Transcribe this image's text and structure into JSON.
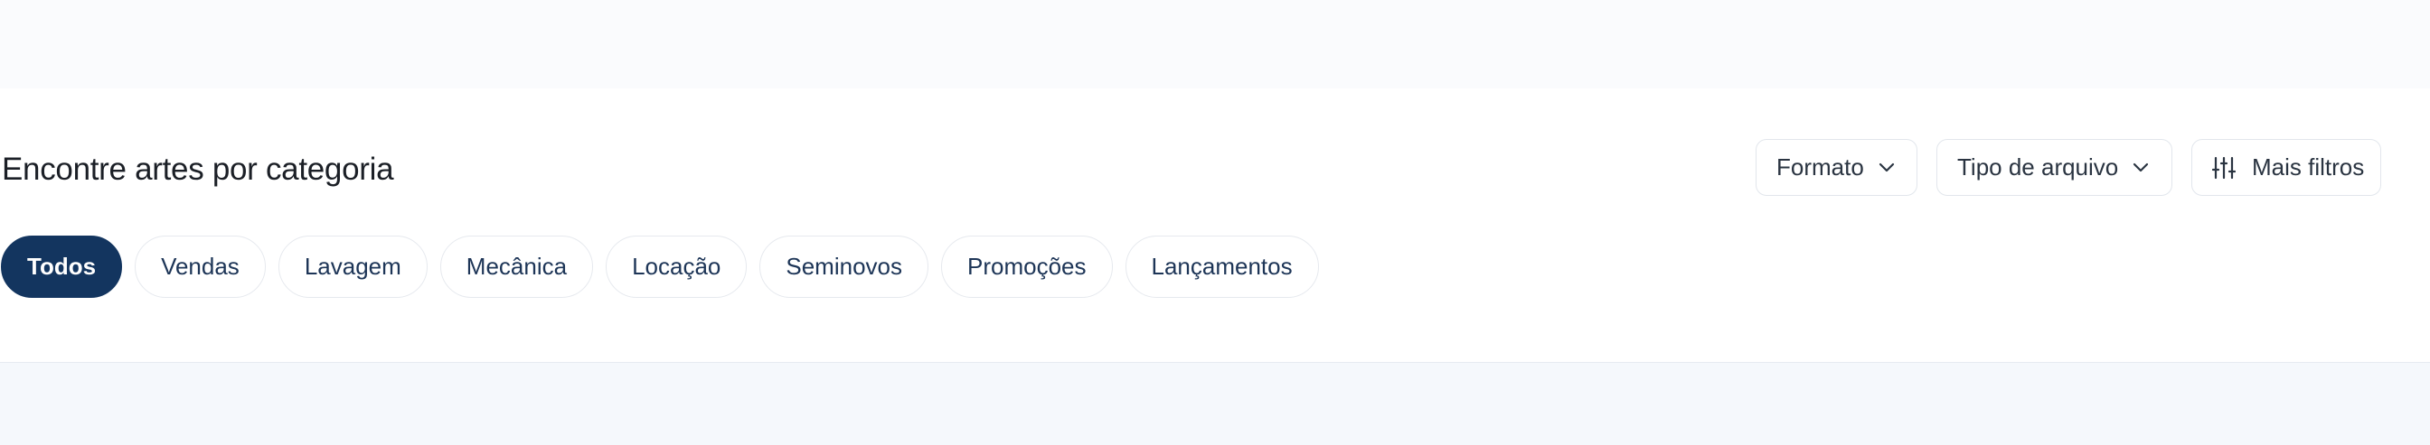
{
  "section": {
    "title": "Encontre artes por categoria"
  },
  "filters": {
    "format_label": "Formato",
    "filetype_label": "Tipo de arquivo",
    "more_label": "Mais filtros",
    "icons": {
      "dropdown": "chevron-down-icon",
      "more": "sliders-icon"
    }
  },
  "categories": {
    "active": "Todos",
    "items": [
      "Todos",
      "Vendas",
      "Lavagem",
      "Mecânica",
      "Locação",
      "Seminovos",
      "Promoções",
      "Lançamentos"
    ]
  },
  "colors": {
    "active_chip_bg": "#13355f",
    "active_chip_text": "#ffffff",
    "chip_text": "#1d3557",
    "border": "#e2e6ec",
    "top_band": "#fafbfd",
    "bottom_band": "#f5f8fc"
  }
}
